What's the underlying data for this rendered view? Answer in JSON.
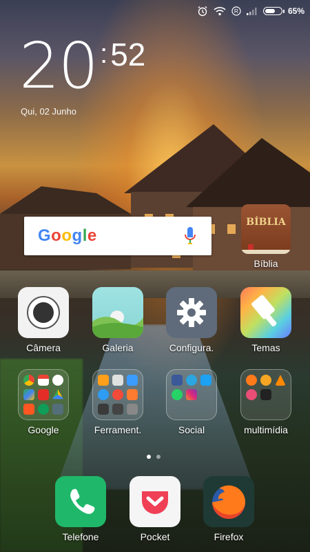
{
  "status_bar": {
    "battery_percent": "65%",
    "battery_level": 0.65,
    "icons": [
      "alarm-icon",
      "wifi-icon",
      "registered-icon",
      "signal-icon",
      "battery-icon"
    ]
  },
  "clock": {
    "hour": "20",
    "minute": "52",
    "date": "Qui, 02 Junho"
  },
  "search_widget": {
    "logo": "Google",
    "icons": [
      "mic-icon"
    ]
  },
  "biblia": {
    "tile_text": "BÍBLIA",
    "label": "Bíblia",
    "color": "#8B4A2B"
  },
  "apps_row1": [
    {
      "label": "Câmera",
      "icon": "camera-icon"
    },
    {
      "label": "Galeria",
      "icon": "gallery-icon"
    },
    {
      "label": "Configura.",
      "icon": "gear-icon"
    },
    {
      "label": "Temas",
      "icon": "themes-brush-icon"
    }
  ],
  "folders": [
    {
      "label": "Google"
    },
    {
      "label": "Ferrament."
    },
    {
      "label": "Social"
    },
    {
      "label": "multimídia"
    }
  ],
  "dock": [
    {
      "label": "Telefone",
      "icon": "phone-icon",
      "color": "#1DB954"
    },
    {
      "label": "Pocket",
      "icon": "pocket-icon",
      "color": "#EF4056"
    },
    {
      "label": "Firefox",
      "icon": "firefox-icon",
      "color": "#FF7A1A"
    }
  ],
  "page_indicator": {
    "pages": 2,
    "current": 1
  }
}
